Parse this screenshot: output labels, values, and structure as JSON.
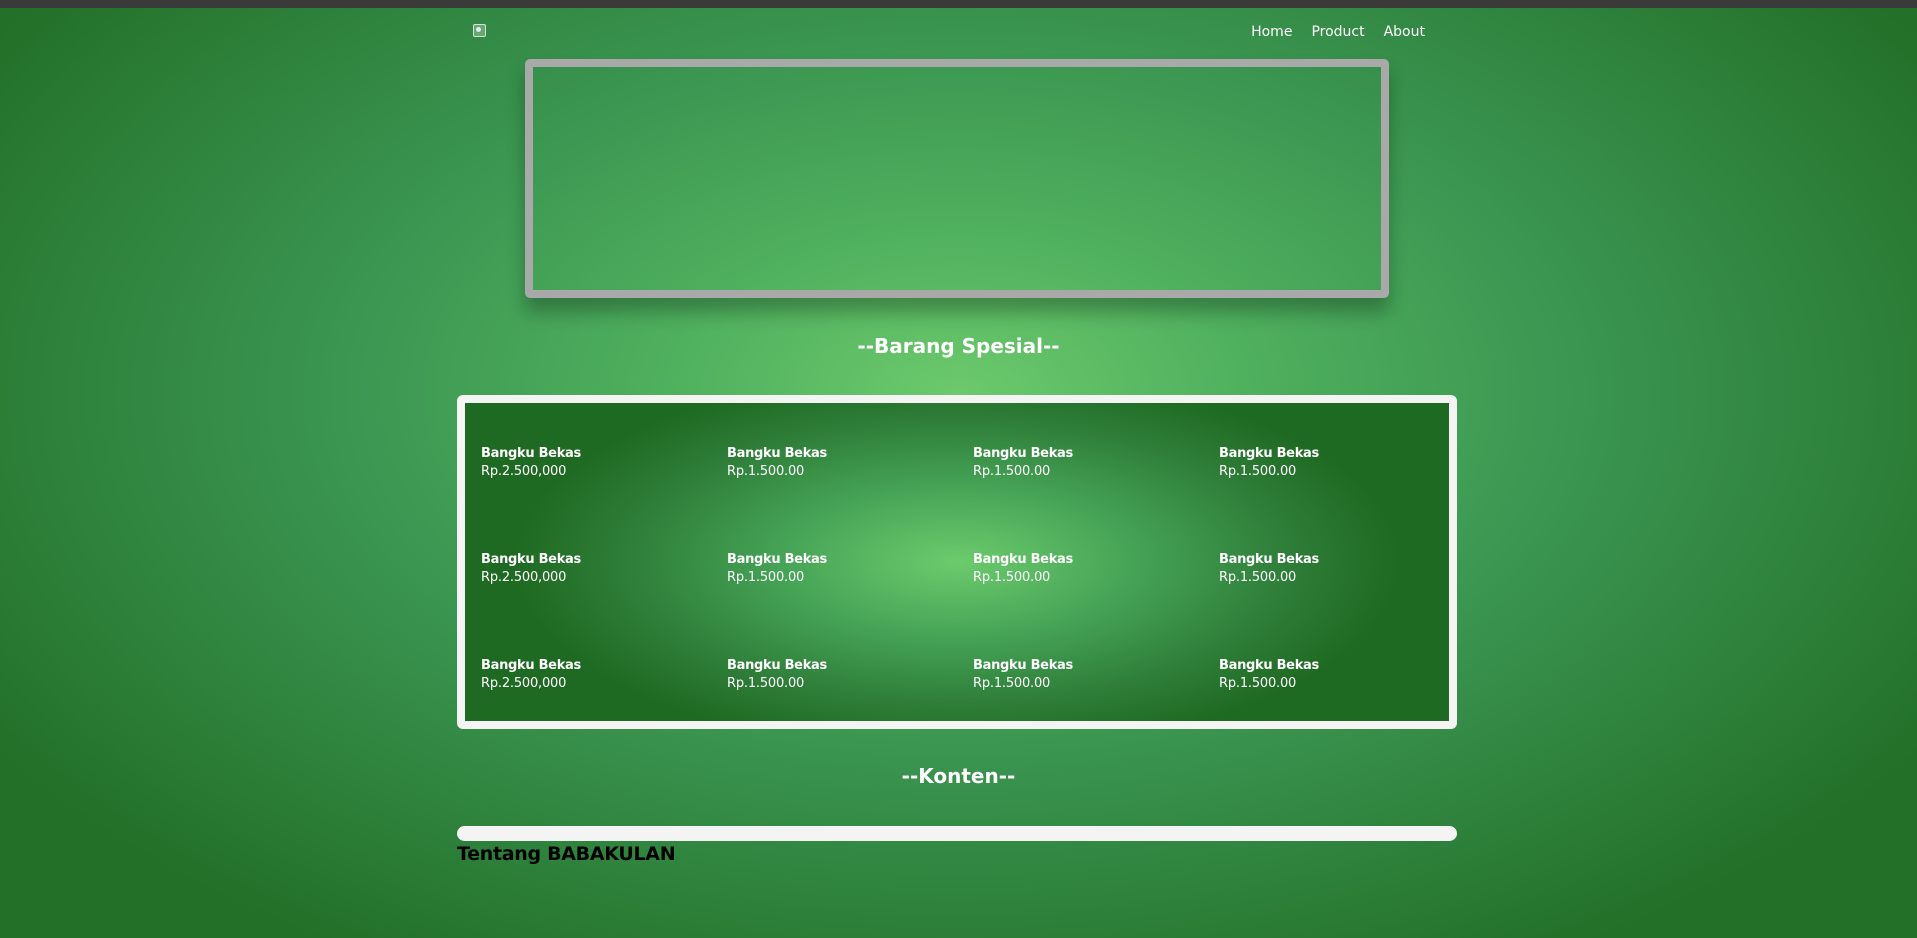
{
  "nav": {
    "items": [
      "Home",
      "Product",
      "About"
    ]
  },
  "sections": {
    "special_title": "--Barang Spesial--",
    "content_title": "--Konten--",
    "about_heading": "Tentang BABAKULAN"
  },
  "products": [
    {
      "name": "Bangku Bekas",
      "price": "Rp.2.500,000"
    },
    {
      "name": "Bangku Bekas",
      "price": "Rp.1.500.00"
    },
    {
      "name": "Bangku Bekas",
      "price": "Rp.1.500.00"
    },
    {
      "name": "Bangku Bekas",
      "price": "Rp.1.500.00"
    },
    {
      "name": "Bangku Bekas",
      "price": "Rp.2.500,000"
    },
    {
      "name": "Bangku Bekas",
      "price": "Rp.1.500.00"
    },
    {
      "name": "Bangku Bekas",
      "price": "Rp.1.500.00"
    },
    {
      "name": "Bangku Bekas",
      "price": "Rp.1.500.00"
    },
    {
      "name": "Bangku Bekas",
      "price": "Rp.2.500,000"
    },
    {
      "name": "Bangku Bekas",
      "price": "Rp.1.500.00"
    },
    {
      "name": "Bangku Bekas",
      "price": "Rp.1.500.00"
    },
    {
      "name": "Bangku Bekas",
      "price": "Rp.1.500.00"
    }
  ],
  "icons": {
    "logo": "broken-image-icon"
  },
  "colors": {
    "accent": "#3a9550",
    "frame": "#a9a9a9",
    "panel_border": "#f4f4f4"
  }
}
